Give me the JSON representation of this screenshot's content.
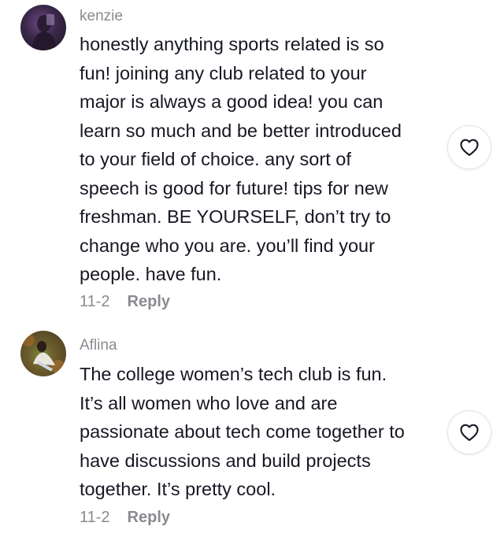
{
  "comments": [
    {
      "username": "kenzie",
      "text_lines": [
        "honestly anything sports related is so",
        "fun! joining any club related to your",
        "major is always a good idea! you can",
        "learn so much and be better introduced",
        "to your field of choice. any sort of",
        "speech is good for future! tips for new",
        "freshman. BE YOURSELF, don’t try to",
        "change who you are. you’ll find your",
        "people. have fun."
      ],
      "date": "11-2",
      "reply_label": "Reply",
      "like_icon": "heart-outline-icon"
    },
    {
      "username": "Aflina",
      "text_lines": [
        "The college women’s tech club is fun.",
        "It’s all women who love and are",
        "passionate about tech come together to",
        "have discussions and build projects",
        "together. It’s pretty cool."
      ],
      "date": "11-2",
      "reply_label": "Reply",
      "like_icon": "heart-outline-icon"
    }
  ]
}
